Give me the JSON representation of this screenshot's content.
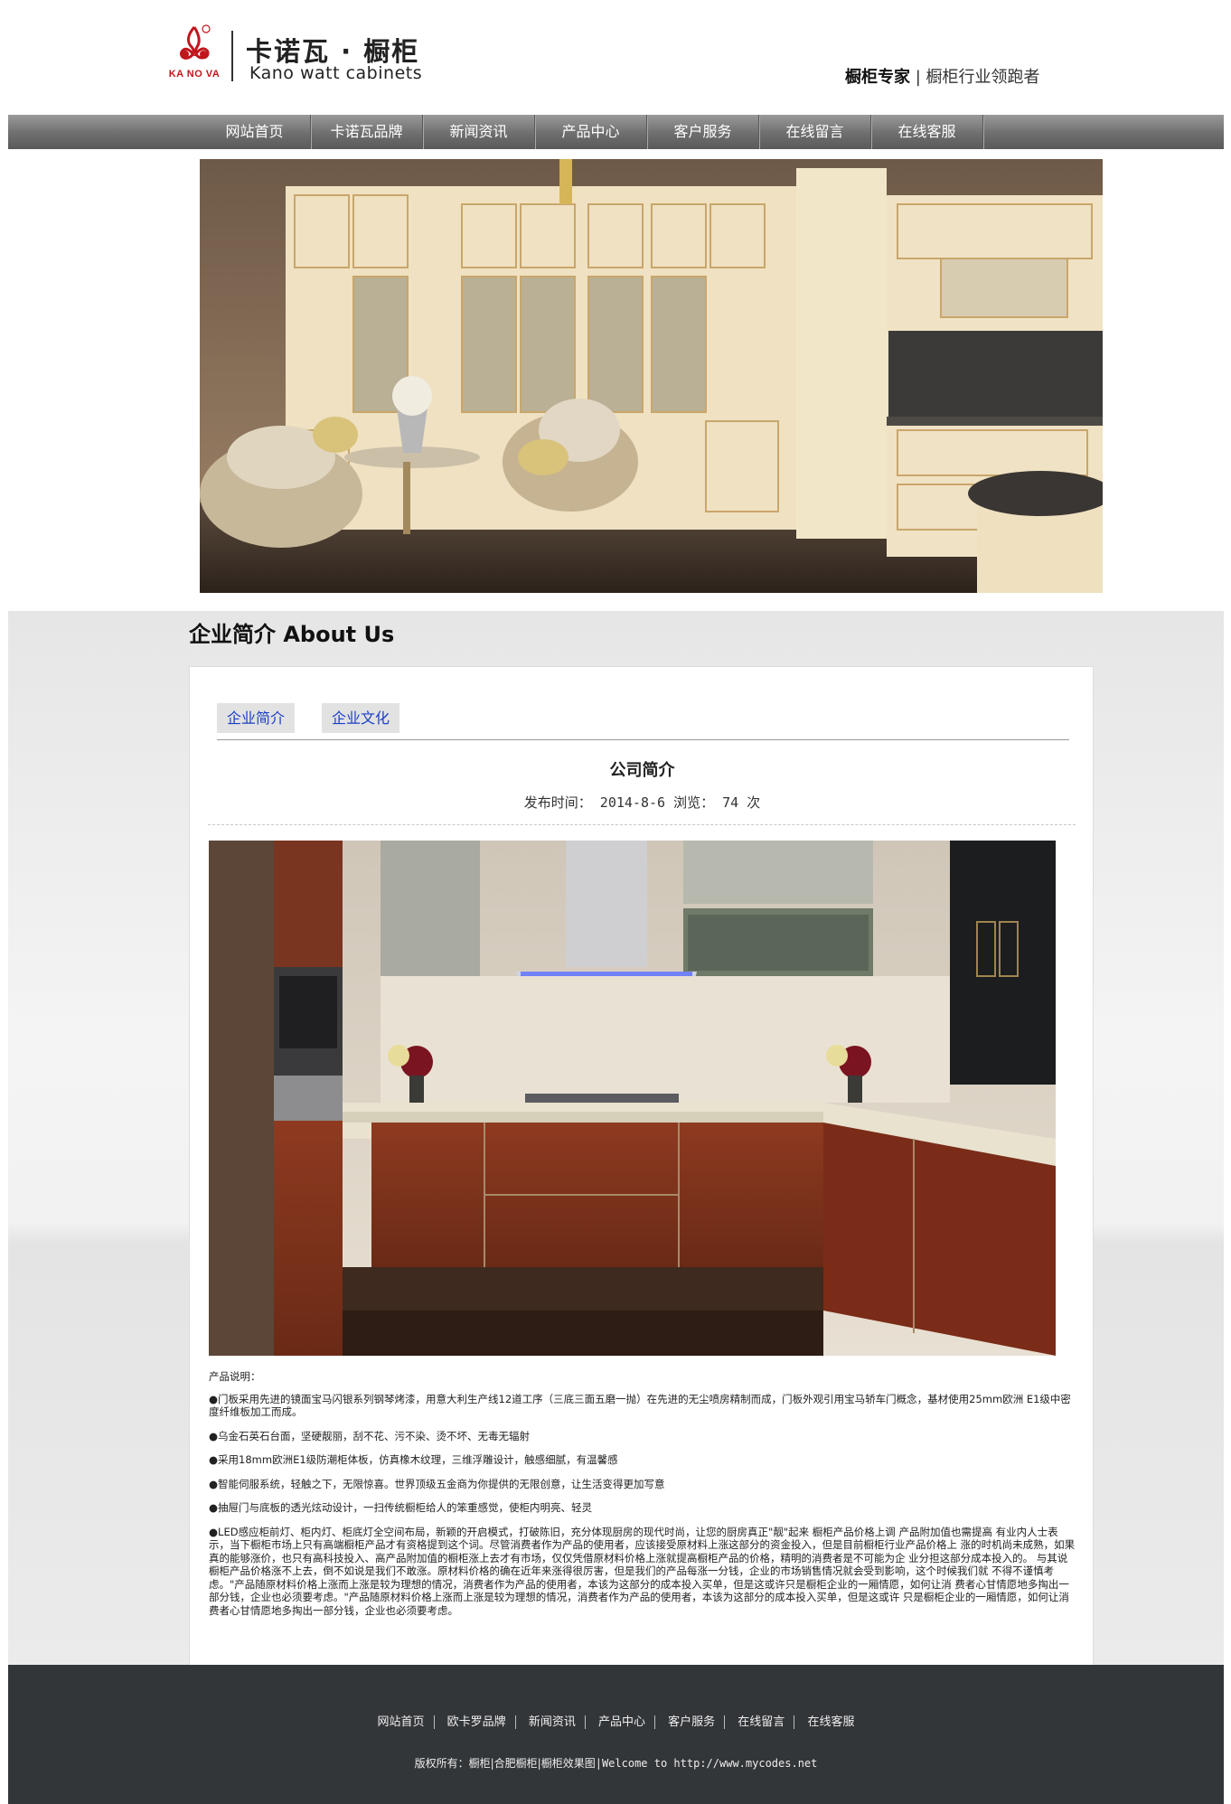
{
  "brand": {
    "logo_en_mark": "KA NO VA",
    "name_cn": "卡诺瓦 · 橱柜",
    "name_en": "Kano watt cabinets",
    "slogan_bold": "橱柜专家",
    "slogan_rest": "橱柜行业领跑者",
    "accent_color": "#c0161c"
  },
  "nav": {
    "items": [
      "网站首页",
      "卡诺瓦品牌",
      "新闻资讯",
      "产品中心",
      "客户服务",
      "在线留言",
      "在线客服"
    ]
  },
  "about": {
    "heading": "企业简介 About Us",
    "tabs": [
      "企业简介",
      "企业文化"
    ],
    "article": {
      "title": "公司简介",
      "meta_date_label": "发布时间：",
      "meta_date": "2014-8-6",
      "meta_views_label": "浏览：",
      "meta_views": "74",
      "meta_views_unit": "次",
      "desc_head": "产品说明：",
      "paragraphs": [
        "●门板采用先进的镜面宝马闪银系列钢琴烤漆，用意大利生产线12道工序（三底三面五磨一抛）在先进的无尘喷房精制而成，门板外观引用宝马轿车门概念，基材使用25mm欧洲 E1级中密度纤维板加工而成。",
        "●乌金石英石台面，坚硬靓丽，刮不花、污不染、烫不坏、无毒无辐射",
        "●采用18mm欧洲E1级防潮柜体板，仿真橡木纹理，三维浮雕设计，触感细腻，有温馨感",
        "●智能伺服系统，轻触之下，无限惊喜。世界顶级五金商为你提供的无限创意，让生活变得更加写意",
        "●抽屉门与底板的透光炫动设计，一扫传统橱柜给人的笨重感觉，使柜内明亮、轻灵",
        "●LED感应柜前灯、柜内灯、柜底灯全空间布局，新颖的开启模式，打破陈旧，充分体现厨房的现代时尚，让您的厨房真正\"靓\"起来 橱柜产品价格上调 产品附加值也需提高 有业内人士表示，当下橱柜市场上只有高端橱柜产品才有资格提到这个词。尽管消费者作为产品的使用者，应该接受原材料上涨这部分的资金投入，但是目前橱柜行业产品价格上 涨的时机尚未成熟，如果真的能够涨价，也只有高科技投入、高产品附加值的橱柜涨上去才有市场，仅仅凭借原材料价格上涨就提高橱柜产品的价格，精明的消费者是不可能为企 业分担这部分成本投入的。 与其说橱柜产品价格涨不上去，倒不如说是我们不敢涨。原材料价格的确在近年来涨得很厉害，但是我们的产品每涨一分钱，企业的市场销售情况就会受到影响，这个时候我们就 不得不谨慎考虑。\"产品随原材料价格上涨而上涨是较为理想的情况，消费者作为产品的使用者，本该为这部分的成本投入买单，但是这或许只是橱柜企业的一厢情愿，如何让消 费者心甘情愿地多掏出一部分钱，企业也必须要考虑。\"产品随原材料价格上涨而上涨是较为理想的情况，消费者作为产品的使用者，本该为这部分的成本投入买单，但是这或许 只是橱柜企业的一厢情愿，如何让消费者心甘情愿地多掏出一部分钱，企业也必须要考虑。"
      ]
    }
  },
  "footer": {
    "links": [
      "网站首页",
      "欧卡罗品牌",
      "新闻资讯",
      "产品中心",
      "客户服务",
      "在线留言",
      "在线客服"
    ],
    "copyright_label": "版权所有：",
    "copyright_sites": "橱柜|合肥橱柜|橱柜效果图",
    "copyright_tail": "|Welcome to http://www.mycodes.net"
  }
}
